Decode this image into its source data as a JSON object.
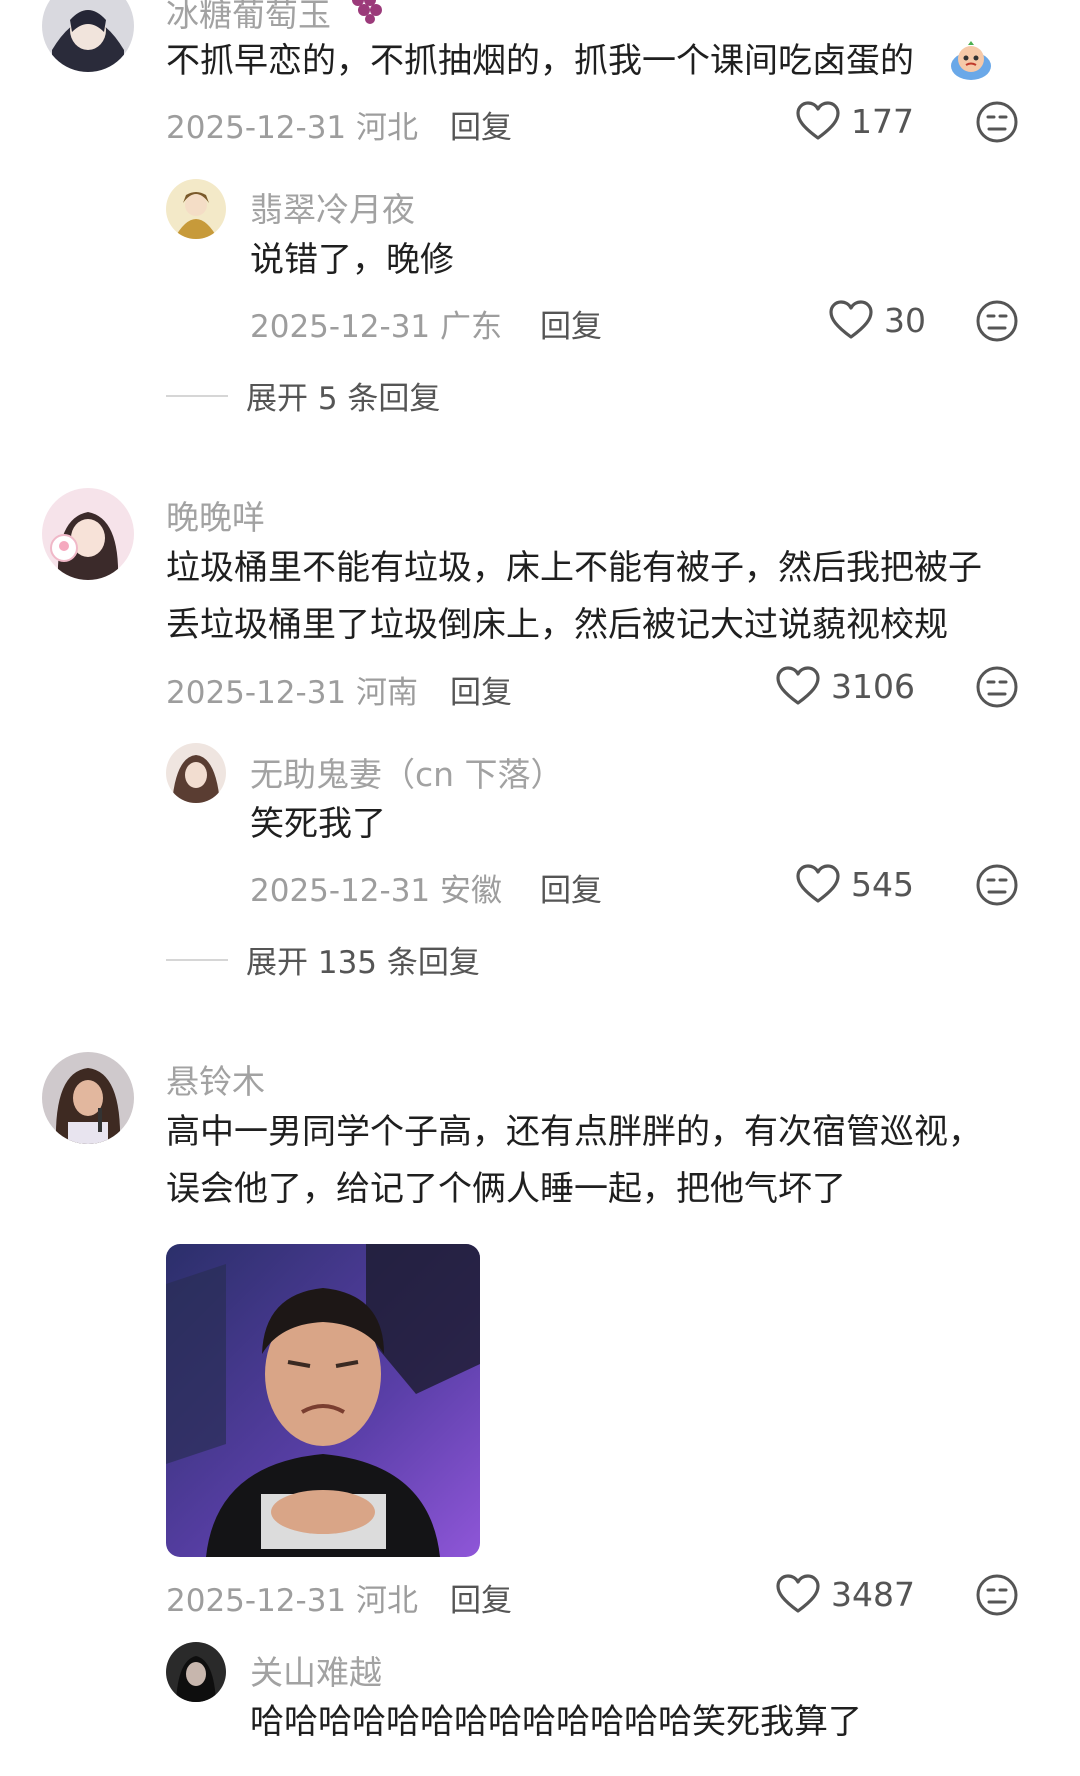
{
  "comments": [
    {
      "username": "冰糖葡萄玉",
      "text": "不抓早恋的，不抓抽烟的，抓我一个课间吃卤蛋的",
      "date": "2025-12-31 河北",
      "reply_label": "回复",
      "likes": "177",
      "replies": [
        {
          "username": "翡翠冷月夜",
          "text": "说错了，晚修",
          "date": "2025-12-31 广东",
          "reply_label": "回复",
          "likes": "30"
        }
      ],
      "expand_label": "展开 5 条回复"
    },
    {
      "username": "晚晚咩",
      "text_lines": [
        "垃圾桶里不能有垃圾，床上不能有被子，然后我把被子",
        "丢垃圾桶里了垃圾倒床上，然后被记大过说藐视校规"
      ],
      "date": "2025-12-31 河南",
      "reply_label": "回复",
      "likes": "3106",
      "replies": [
        {
          "username": "无助鬼妻（cn 下落）",
          "text": "笑死我了",
          "date": "2025-12-31 安徽",
          "reply_label": "回复",
          "likes": "545"
        }
      ],
      "expand_label": "展开 135 条回复"
    },
    {
      "username": "悬铃木",
      "text_lines": [
        "高中一男同学个子高，还有点胖胖的，有次宿管巡视，",
        "误会他了，给记了个俩人睡一起，把他气坏了"
      ],
      "date": "2025-12-31 河北",
      "reply_label": "回复",
      "likes": "3487",
      "replies": [
        {
          "username": "关山难越",
          "text": "哈哈哈哈哈哈哈哈哈哈哈哈哈笑死我算了"
        }
      ]
    }
  ],
  "icons": {
    "like": "heart-outline-icon",
    "dislike": "neutral-face-icon",
    "emoji": "crying-emoji-icon"
  },
  "colors": {
    "username": "#a2a2a2",
    "text": "#1f1f1f",
    "meta": "#9d9d9d",
    "action": "#555555"
  }
}
